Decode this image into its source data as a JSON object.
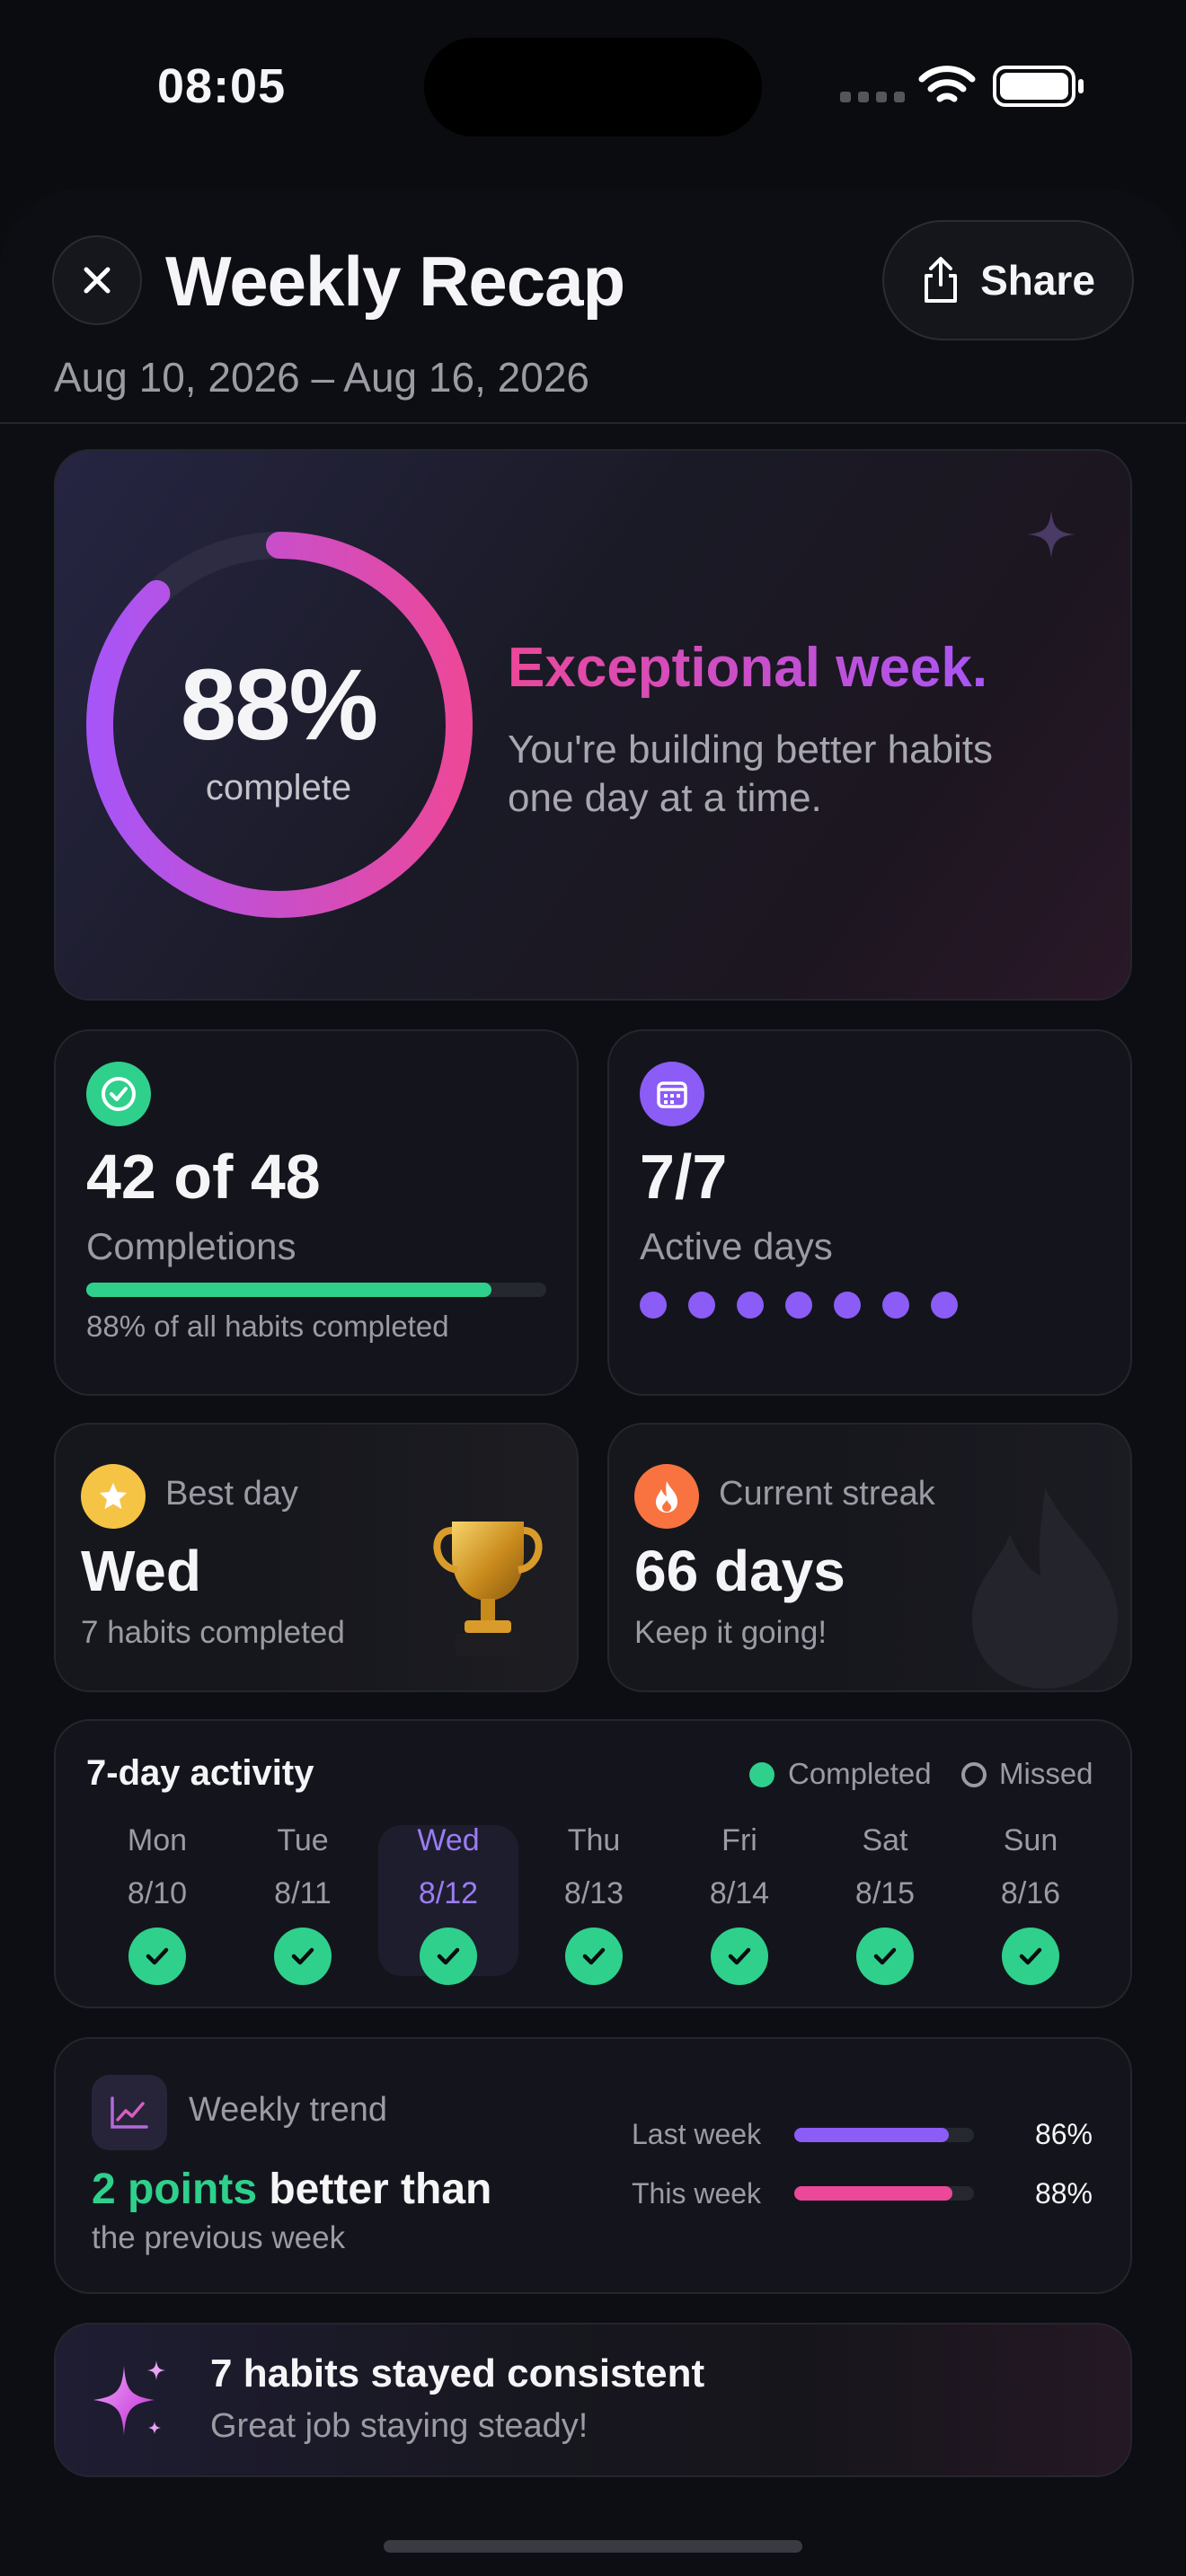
{
  "status_bar": {
    "time": "08:05"
  },
  "header": {
    "title": "Weekly Recap",
    "share_label": "Share",
    "date_range": "Aug 10, 2026 – Aug 16, 2026"
  },
  "hero": {
    "percent": "88%",
    "percent_value": 0.88,
    "complete_label": "complete",
    "headline": "Exceptional week.",
    "subtext": "You're building better habits one day at a time.",
    "ring_gradient": [
      "#a855f7",
      "#ec4899"
    ]
  },
  "completions": {
    "value": "42 of 48",
    "label": "Completions",
    "progress": 0.88,
    "caption": "88% of all habits completed",
    "color": "#2fd08c"
  },
  "active_days": {
    "value": "7/7",
    "label": "Active days",
    "dots": 7,
    "color": "#8b5cf6"
  },
  "best_day": {
    "label": "Best day",
    "value": "Wed",
    "caption": "7 habits completed",
    "color": "#f6c445"
  },
  "streak": {
    "label": "Current streak",
    "value": "66 days",
    "caption": "Keep it going!",
    "color": "#f97341"
  },
  "activity": {
    "title": "7-day activity",
    "legend_completed": "Completed",
    "legend_missed": "Missed",
    "days": [
      {
        "day": "Mon",
        "date": "8/10",
        "completed": true
      },
      {
        "day": "Tue",
        "date": "8/11",
        "completed": true
      },
      {
        "day": "Wed",
        "date": "8/12",
        "completed": true,
        "highlight": true
      },
      {
        "day": "Thu",
        "date": "8/13",
        "completed": true
      },
      {
        "day": "Fri",
        "date": "8/14",
        "completed": true
      },
      {
        "day": "Sat",
        "date": "8/15",
        "completed": true
      },
      {
        "day": "Sun",
        "date": "8/16",
        "completed": true
      }
    ]
  },
  "trend": {
    "label": "Weekly trend",
    "highlight": "2 points",
    "headline_rest": "better than",
    "subtext": "the previous week",
    "last_week_label": "Last week",
    "last_week_value": "86%",
    "last_week_fraction": 0.86,
    "this_week_label": "This week",
    "this_week_value": "88%",
    "this_week_fraction": 0.88,
    "last_color": "#8b5cf6",
    "this_color": "#ec4899"
  },
  "consistency": {
    "title": "7 habits stayed consistent",
    "subtitle": "Great job staying steady!"
  }
}
